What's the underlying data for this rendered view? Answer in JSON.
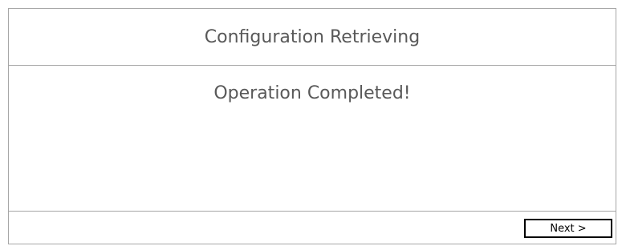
{
  "dialog": {
    "title": "Configuration Retrieving",
    "message": "Operation Completed!",
    "next_button_label": "Next >"
  },
  "colors": {
    "border": "#a6a6a6",
    "text": "#595959",
    "button_border": "#000000",
    "background": "#ffffff"
  }
}
